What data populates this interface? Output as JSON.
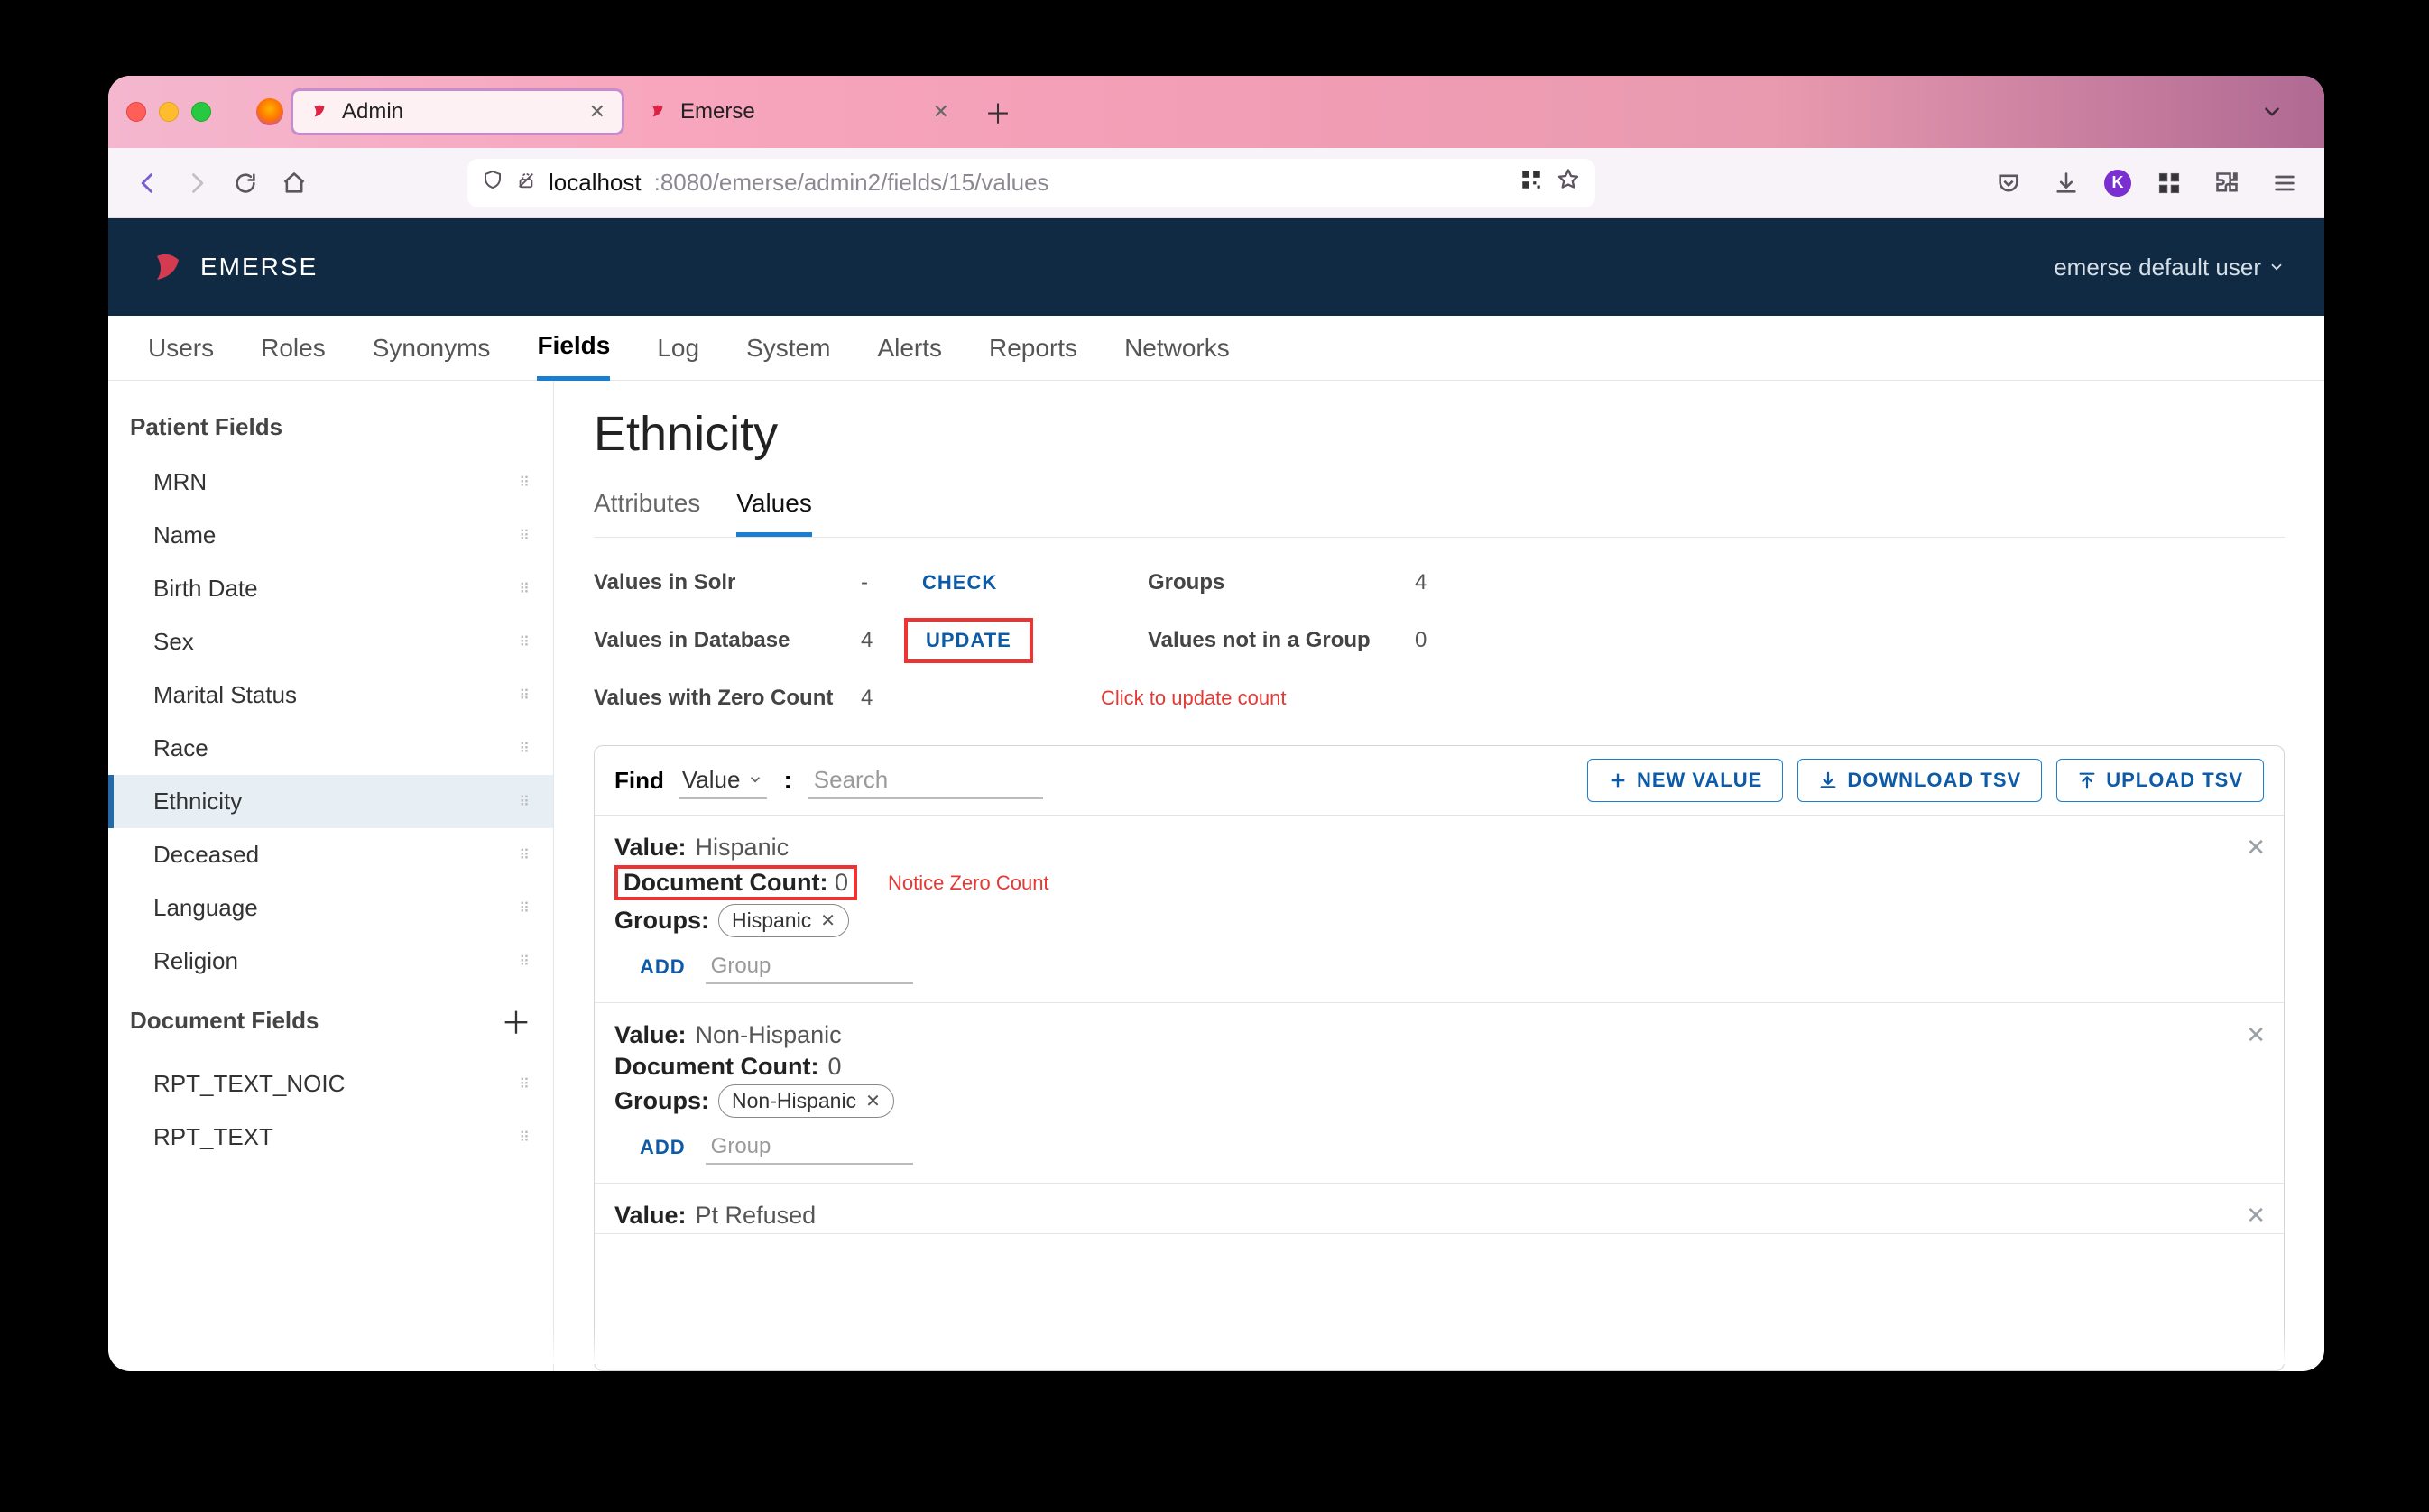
{
  "browser": {
    "tabs": [
      {
        "title": "Admin",
        "active": true
      },
      {
        "title": "Emerse",
        "active": false
      }
    ],
    "url_host": "localhost",
    "url_path": ":8080/emerse/admin2/fields/15/values"
  },
  "app": {
    "brand": "EMERSE",
    "user": "emerse default user"
  },
  "nav": {
    "items": [
      "Users",
      "Roles",
      "Synonyms",
      "Fields",
      "Log",
      "System",
      "Alerts",
      "Reports",
      "Networks"
    ],
    "active_index": 3
  },
  "sidebar": {
    "sections": [
      {
        "title": "Patient Fields",
        "plus": false,
        "items": [
          "MRN",
          "Name",
          "Birth Date",
          "Sex",
          "Marital Status",
          "Race",
          "Ethnicity",
          "Deceased",
          "Language",
          "Religion"
        ],
        "active_index": 6
      },
      {
        "title": "Document Fields",
        "plus": true,
        "items": [
          "RPT_TEXT_NOIC",
          "RPT_TEXT"
        ],
        "active_index": -1
      }
    ]
  },
  "page": {
    "title": "Ethnicity",
    "subtabs": [
      "Attributes",
      "Values"
    ],
    "subtab_active": 1
  },
  "stats": {
    "rows": [
      {
        "label": "Values in Solr",
        "value": "-",
        "button": "CHECK",
        "highlight": false,
        "label2": "Groups",
        "value2": "4"
      },
      {
        "label": "Values in Database",
        "value": "4",
        "button": "UPDATE",
        "highlight": true,
        "label2": "Values not in a Group",
        "value2": "0"
      },
      {
        "label": "Values with Zero Count",
        "value": "4",
        "button": "",
        "highlight": false,
        "note": "Click to update count"
      }
    ]
  },
  "find": {
    "label": "Find",
    "dropdown": "Value",
    "placeholder": "Search",
    "buttons": {
      "new_value": "NEW VALUE",
      "download_tsv": "DOWNLOAD TSV",
      "upload_tsv": "UPLOAD TSV"
    }
  },
  "values": [
    {
      "value": "Hispanic",
      "doc_count": "0",
      "doc_highlight": true,
      "note": "Notice Zero Count",
      "groups": [
        "Hispanic"
      ],
      "add_label": "ADD",
      "group_placeholder": "Group"
    },
    {
      "value": "Non-Hispanic",
      "doc_count": "0",
      "doc_highlight": false,
      "groups": [
        "Non-Hispanic"
      ],
      "add_label": "ADD",
      "group_placeholder": "Group"
    },
    {
      "value": "Pt Refused",
      "partial": true
    }
  ],
  "labels": {
    "value": "Value:",
    "doc_count": "Document Count:",
    "groups": "Groups:"
  }
}
